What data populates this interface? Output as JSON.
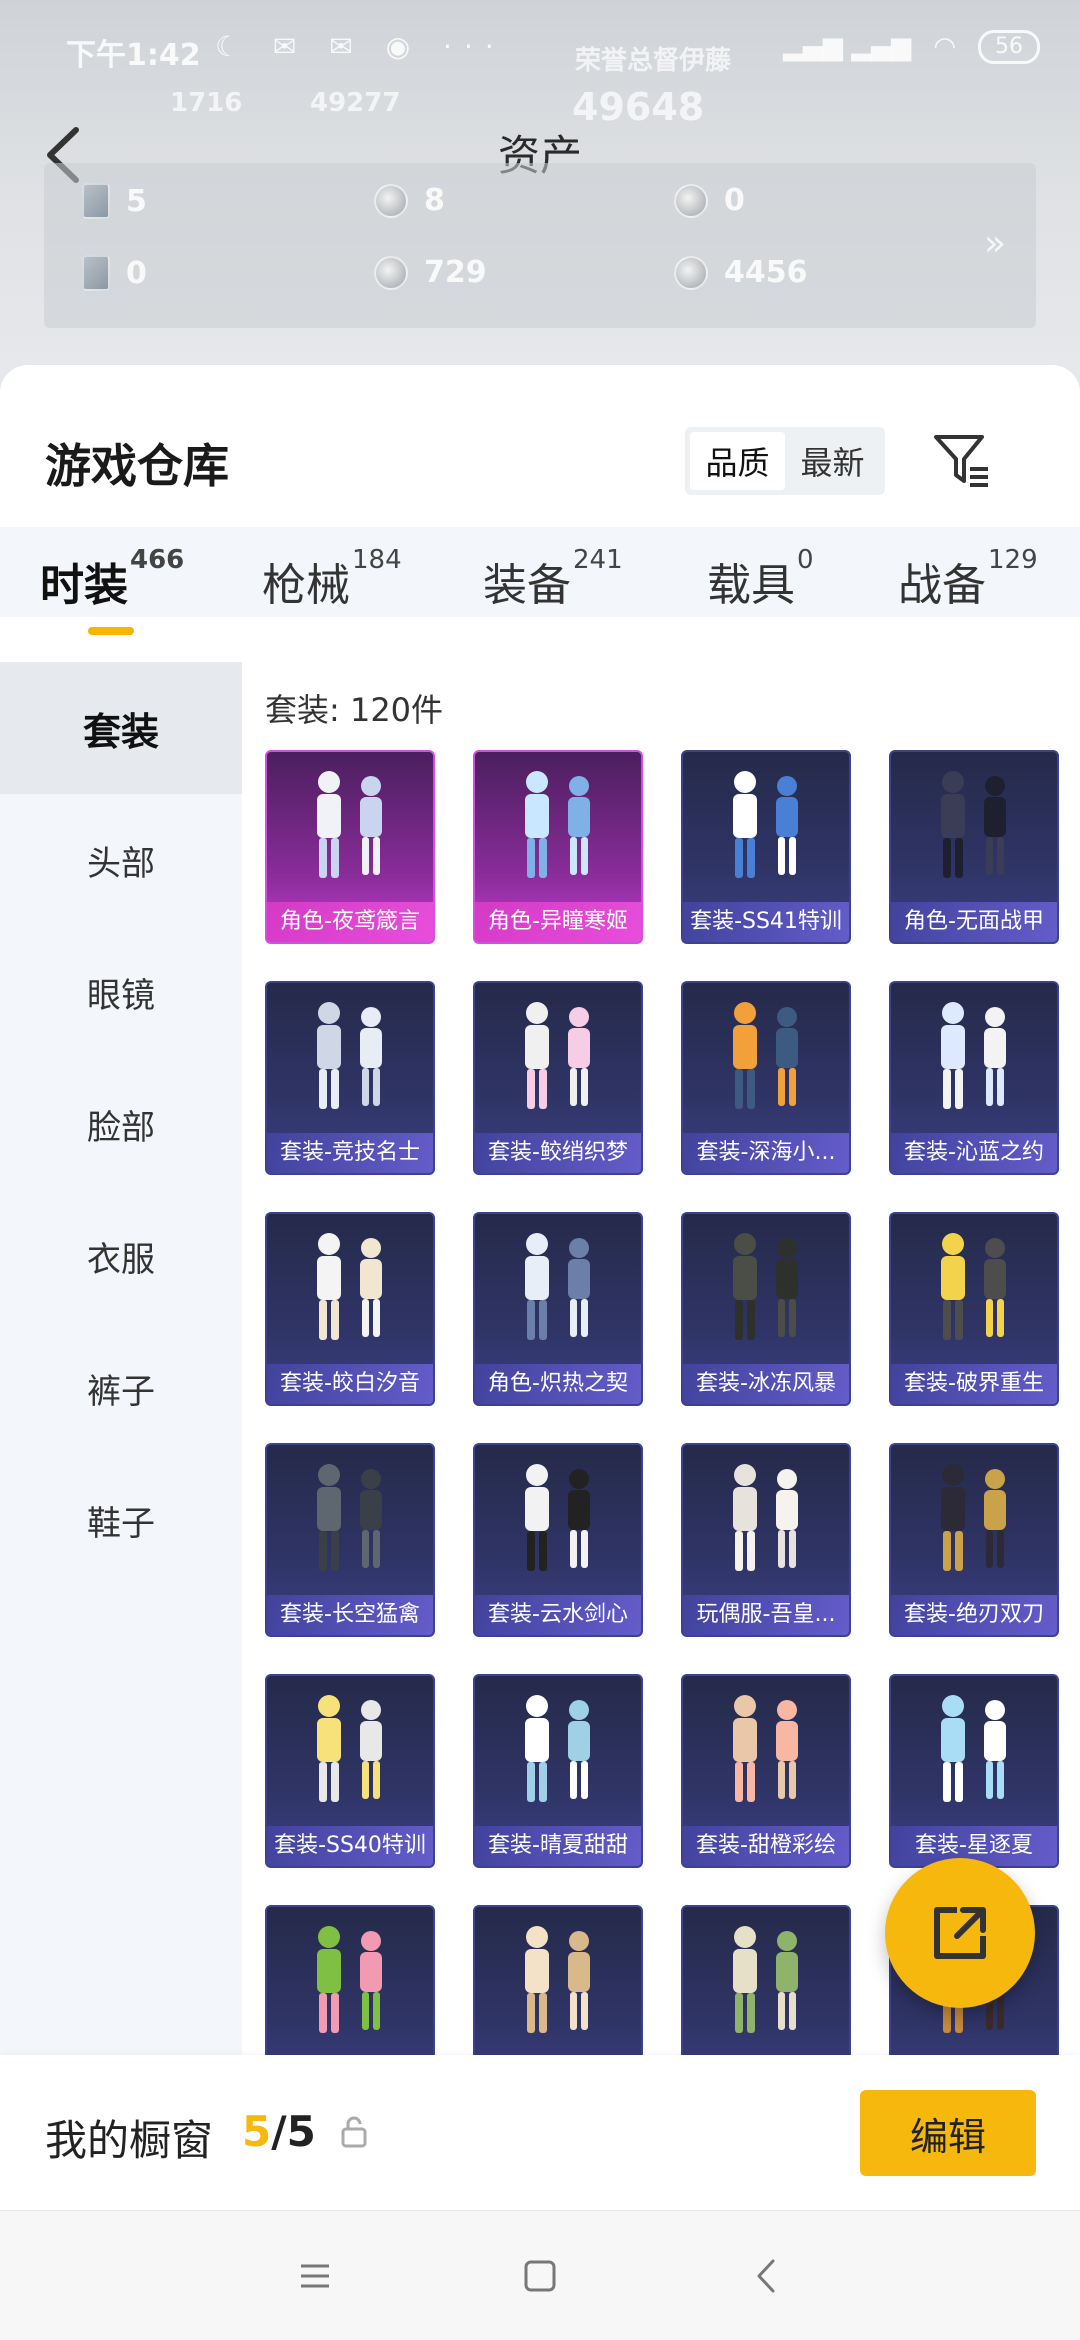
{
  "status_bar": {
    "time": "下午1:42",
    "battery": "56"
  },
  "header": {
    "title": "资产",
    "ghost_score": "49648",
    "ghost_left_a": "1716",
    "ghost_left_b": "49277",
    "ghost_right": "荣誉总督伊藤"
  },
  "assets": [
    {
      "icon": "card-icon",
      "value": "5"
    },
    {
      "icon": "coin-icon",
      "value": "8"
    },
    {
      "icon": "coin-icon",
      "value": "0"
    },
    {
      "icon": "card-icon",
      "value": "0"
    },
    {
      "icon": "coin-icon",
      "value": "729"
    },
    {
      "icon": "coin-icon",
      "value": "4456"
    }
  ],
  "warehouse": {
    "title": "游戏仓库",
    "sort_options": [
      "品质",
      "最新"
    ],
    "sort_selected": "品质"
  },
  "tabs": [
    {
      "label": "时装",
      "count": "466"
    },
    {
      "label": "枪械",
      "count": "184"
    },
    {
      "label": "装备",
      "count": "241"
    },
    {
      "label": "载具",
      "count": "0"
    },
    {
      "label": "战备",
      "count": "129"
    }
  ],
  "categories": [
    "套装",
    "头部",
    "眼镜",
    "脸部",
    "衣服",
    "裤子",
    "鞋子"
  ],
  "count_label": "套装: 120件",
  "items": [
    {
      "name": "角色-夜鸢箴言",
      "rarity": "legendary"
    },
    {
      "name": "角色-异瞳寒姬",
      "rarity": "legendary"
    },
    {
      "name": "套装-SS41特训",
      "rarity": "epic"
    },
    {
      "name": "角色-无面战甲",
      "rarity": "epic"
    },
    {
      "name": "套装-竞技名士",
      "rarity": "epic"
    },
    {
      "name": "套装-鲛绡织梦",
      "rarity": "epic"
    },
    {
      "name": "套装-深海小...",
      "rarity": "epic"
    },
    {
      "name": "套装-沁蓝之约",
      "rarity": "epic"
    },
    {
      "name": "套装-皎白汐音",
      "rarity": "epic"
    },
    {
      "name": "角色-炽热之契",
      "rarity": "epic"
    },
    {
      "name": "套装-冰冻风暴",
      "rarity": "epic"
    },
    {
      "name": "套装-破界重生",
      "rarity": "epic"
    },
    {
      "name": "套装-长空猛禽",
      "rarity": "epic"
    },
    {
      "name": "套装-云水剑心",
      "rarity": "epic"
    },
    {
      "name": "玩偶服-吾皇...",
      "rarity": "epic"
    },
    {
      "name": "套装-绝刃双刀",
      "rarity": "epic"
    },
    {
      "name": "套装-SS40特训",
      "rarity": "epic"
    },
    {
      "name": "套装-晴夏甜甜",
      "rarity": "epic"
    },
    {
      "name": "套装-甜橙彩绘",
      "rarity": "epic"
    },
    {
      "name": "套装-星逐夏",
      "rarity": "epic"
    },
    {
      "name": "",
      "rarity": "epic"
    },
    {
      "name": "",
      "rarity": "epic"
    },
    {
      "name": "",
      "rarity": "epic"
    },
    {
      "name": "",
      "rarity": "epic"
    }
  ],
  "showcase": {
    "label": "我的橱窗",
    "current": "5",
    "total": "/5",
    "edit_label": "编辑"
  },
  "colors": {
    "accent": "#f6b80c",
    "legendary": "#d54ee3",
    "epic": "#3c4190"
  }
}
